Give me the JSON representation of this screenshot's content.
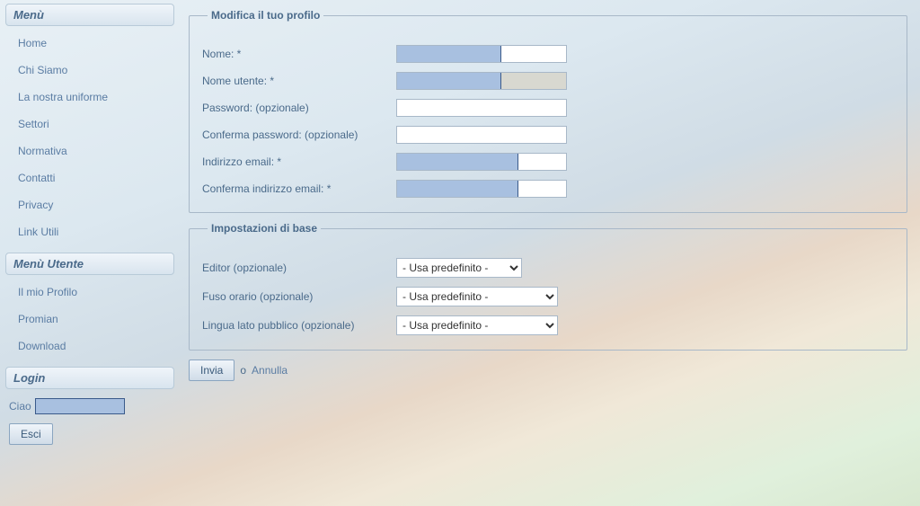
{
  "sidebar": {
    "menu_heading": "Menù",
    "menu_items": [
      {
        "label": "Home"
      },
      {
        "label": "Chi Siamo"
      },
      {
        "label": "La nostra uniforme"
      },
      {
        "label": "Settori"
      },
      {
        "label": "Normativa"
      },
      {
        "label": "Contatti"
      },
      {
        "label": "Privacy"
      },
      {
        "label": "Link Utili"
      }
    ],
    "user_menu_heading": "Menù Utente",
    "user_menu_items": [
      {
        "label": "Il mio Profilo"
      },
      {
        "label": "Promian"
      },
      {
        "label": "Download"
      }
    ],
    "login_heading": "Login",
    "greeting": "Ciao",
    "logout_label": "Esci"
  },
  "profile_form": {
    "legend": "Modifica il tuo profilo",
    "fields": {
      "name_label": "Nome: *",
      "username_label": "Nome utente: *",
      "password_label": "Password: (opzionale)",
      "confirm_password_label": "Conferma password: (opzionale)",
      "email_label": "Indirizzo email: *",
      "confirm_email_label": "Conferma indirizzo email: *"
    }
  },
  "basic_settings": {
    "legend": "Impostazioni di base",
    "fields": {
      "editor_label": "Editor (opzionale)",
      "timezone_label": "Fuso orario (opzionale)",
      "frontend_language_label": "Lingua lato pubblico (opzionale)"
    },
    "default_option": "- Usa predefinito -"
  },
  "actions": {
    "submit_label": "Invia",
    "or_text": "o",
    "cancel_label": "Annulla"
  }
}
